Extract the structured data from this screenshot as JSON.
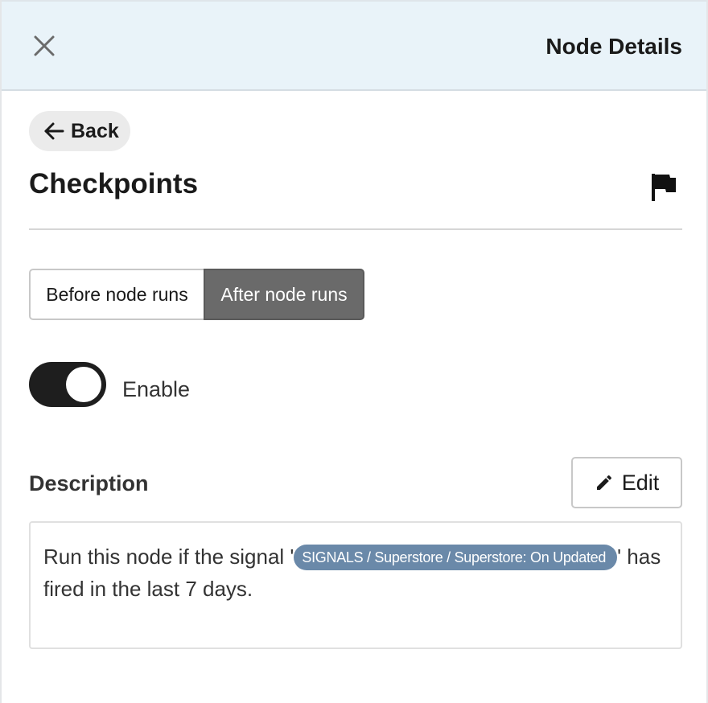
{
  "header": {
    "title": "Node Details",
    "close_icon": "close-icon"
  },
  "back_button": {
    "label": "Back",
    "icon": "arrow-left-icon"
  },
  "section": {
    "title": "Checkpoints",
    "icon": "flag-icon"
  },
  "tabs": [
    {
      "label": "Before node runs",
      "selected": false
    },
    {
      "label": "After node runs",
      "selected": true
    }
  ],
  "toggle": {
    "label": "Enable",
    "on": true
  },
  "description": {
    "label": "Description",
    "edit_label": "Edit",
    "edit_icon": "pencil-icon",
    "text_before": "Run this node if the signal '",
    "signal": "SIGNALS / Superstore / Superstore: On Updated",
    "text_after": "' has fired in the last 7 days."
  },
  "colors": {
    "header_bg": "#e9f3f9",
    "selected_tab": "#6a6a6a",
    "toggle_on": "#1e1e1e",
    "signal_chip": "#6a89a9"
  }
}
